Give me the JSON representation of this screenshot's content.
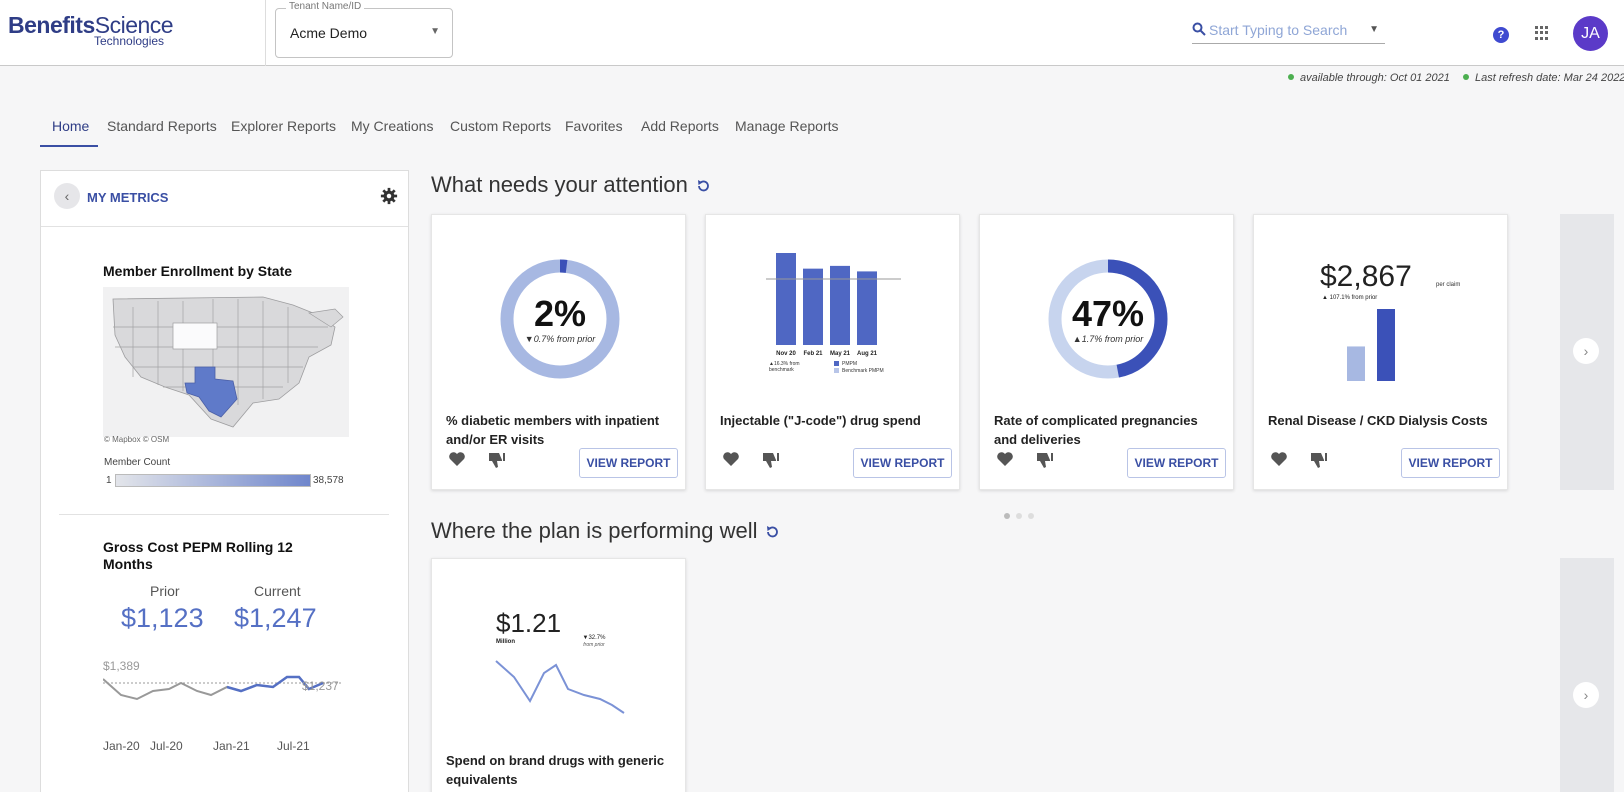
{
  "header": {
    "logo_bold": "Benefits",
    "logo_light": "Science",
    "logo_sub": "Technologies",
    "tenant_label": "Tenant Name/ID",
    "tenant_value": "Acme Demo",
    "search_placeholder": "Start Typing to Search",
    "help_glyph": "?",
    "avatar_initials": "JA"
  },
  "status": {
    "available": "available through: Oct 01 2021",
    "refresh": "Last refresh date: Mar 24 2022"
  },
  "tabs": [
    "Home",
    "Standard Reports",
    "Explorer Reports",
    "My Creations",
    "Custom Reports",
    "Favorites",
    "Add Reports",
    "Manage Reports"
  ],
  "metrics_panel": {
    "title": "MY METRICS",
    "enrollment": {
      "title": "Member Enrollment by State",
      "credit": "© Mapbox © OSM",
      "legend_label": "Member Count",
      "legend_min": "1",
      "legend_max": "38,578"
    },
    "gross_cost": {
      "title_line1": "Gross Cost PEPM Rolling 12",
      "title_line2": "Months",
      "prior_label": "Prior",
      "current_label": "Current",
      "prior_value": "$1,123",
      "current_value": "$1,247",
      "ref_label": "$1,389",
      "end_label": "$1,237",
      "ticks": [
        "Jan-20",
        "Jul-20",
        "Jan-21",
        "Jul-21"
      ]
    }
  },
  "sections": {
    "attention_title": "What needs your attention",
    "performing_title": "Where the plan is performing well"
  },
  "cards": [
    {
      "title": "% diabetic members with inpatient and/or ER visits",
      "big_value": "2%",
      "change": "▼0.7% from prior",
      "fill_fraction": 0.02,
      "button": "VIEW REPORT"
    },
    {
      "title": "Injectable (\"J-code\") drug spend",
      "bar_labels": [
        "Nov 20",
        "Feb 21",
        "May 21",
        "Aug 21"
      ],
      "bar_values": [
        1.0,
        0.83,
        0.86,
        0.8
      ],
      "benchmark_note_1": "▲16.3% from",
      "benchmark_note_2": "benchmark",
      "legend": [
        "PMPM",
        "Benchmark PMPM"
      ],
      "button": "VIEW REPORT"
    },
    {
      "title": "Rate of complicated pregnancies and deliveries",
      "big_value": "47%",
      "change": "▲1.7% from prior",
      "fill_fraction": 0.47,
      "button": "VIEW REPORT"
    },
    {
      "title": "Renal Disease / CKD Dialysis Costs",
      "big_value": "$2,867",
      "unit": "per claim",
      "change": "▲ 107.1% from prior",
      "bar_values": [
        0.48,
        1.0
      ],
      "button": "VIEW REPORT"
    }
  ],
  "performing_cards": [
    {
      "title": "Spend on brand drugs with generic equivalents",
      "big_value": "$1.21",
      "unit": "Million",
      "change_1": "▼32.7%",
      "change_2": "from prior"
    }
  ],
  "colors": {
    "brand": "#2f3d86",
    "accent": "#3a4fa4",
    "donut_light": "#a7b8e2",
    "donut_dark": "#3b51b8",
    "avatar": "#5b3ac8"
  }
}
